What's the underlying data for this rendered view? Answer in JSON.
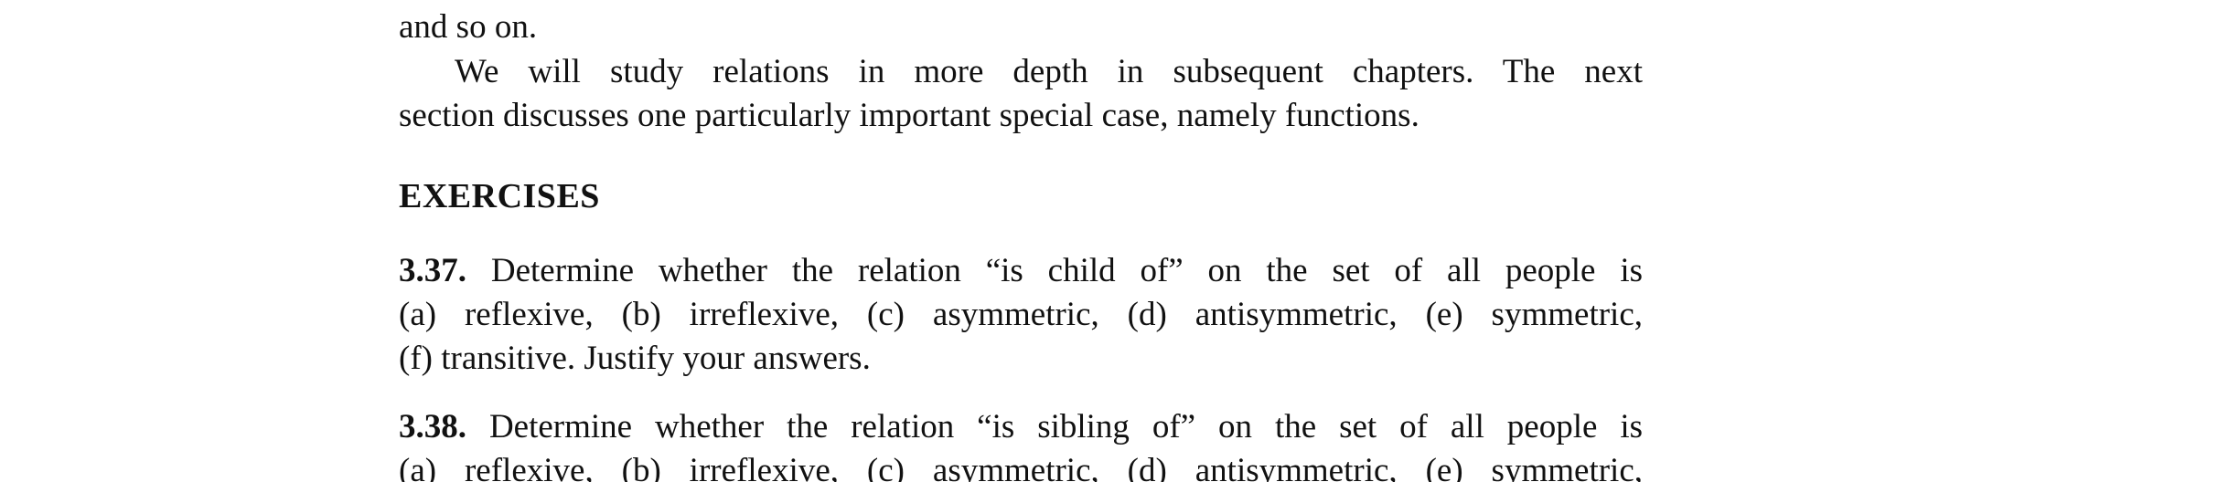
{
  "prev": {
    "cut_line": "and so on.",
    "para2_lines": [
      "We will study relations in more depth in subsequent chapters. The next",
      "section discusses one particularly important special case, namely functions."
    ]
  },
  "exercises": {
    "heading": "EXERCISES",
    "items": [
      {
        "number": "3.37.",
        "lines": [
          "Determine whether the relation “is child of” on the set of all people is",
          "(a) reflexive, (b) irreflexive, (c) asymmetric, (d) antisymmetric, (e) symmetric,",
          "(f) transitive. Justify your answers."
        ]
      },
      {
        "number": "3.38.",
        "lines": [
          "Determine whether the relation “is sibling of” on the set of all people is",
          "(a) reflexive, (b) irreflexive, (c) asymmetric, (d) antisymmetric, (e) symmetric,"
        ]
      }
    ]
  }
}
